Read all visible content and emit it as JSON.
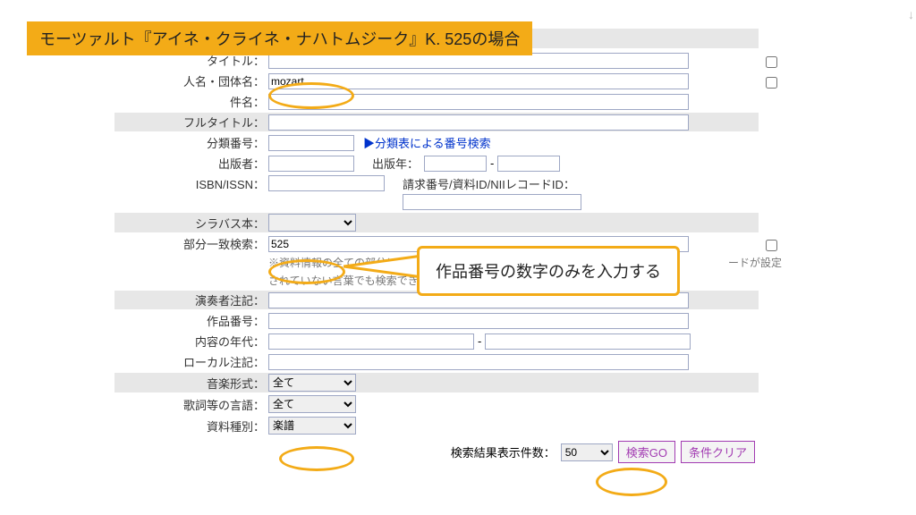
{
  "banner": "モーツァルト『アイネ・クライネ・ナハトムジーク』K. 525の場合",
  "labels": {
    "title": "タイトル：",
    "person": "人名・団体名：",
    "subject": "件名：",
    "fulltitle": "フルタイトル：",
    "classno": "分類番号：",
    "classlink": "▶分類表による番号検索",
    "publisher": "出版者：",
    "pubyear": "出版年：",
    "isbn": "ISBN/ISSN：",
    "callno_label": "請求番号/資料ID/NIIレコードID：",
    "syllabus": "シラバス本：",
    "partial": "部分一致検索：",
    "note1": "※資料情報の全ての部分に対",
    "note1b": "ードが設定",
    "note2": "されていない言葉でも検索できます。",
    "perfnote": "演奏者注記：",
    "workno": "作品番号：",
    "era": "内容の年代：",
    "localnote": "ローカル注記：",
    "musicform": "音楽形式：",
    "lyriclang": "歌詞等の言語：",
    "mattype": "資料種別：",
    "resultcount": "検索結果表示件数：",
    "dash": "-"
  },
  "values": {
    "person": "mozart",
    "partial": "525",
    "musicform": "全て",
    "lyriclang": "全て",
    "mattype": "楽譜",
    "resultcount": "50"
  },
  "buttons": {
    "go": "検索GO",
    "clear": "条件クリア"
  },
  "callout": "作品番号の数字のみを入力する"
}
